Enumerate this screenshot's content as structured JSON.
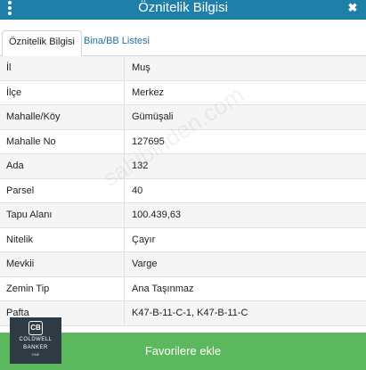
{
  "header": {
    "title": "Öznitelik Bilgisi",
    "menu_icon": "kebab-menu-icon",
    "close_glyph": "✖"
  },
  "tabs": [
    {
      "label": "Öznitelik Bilgisi",
      "active": true
    },
    {
      "label": "Bina/BB Listesi",
      "active": false
    }
  ],
  "rows": [
    {
      "key": "İl",
      "value": "Muş"
    },
    {
      "key": "İlçe",
      "value": "Merkez"
    },
    {
      "key": "Mahalle/Köy",
      "value": "Gümüşali"
    },
    {
      "key": "Mahalle No",
      "value": "127695"
    },
    {
      "key": "Ada",
      "value": "132"
    },
    {
      "key": "Parsel",
      "value": "40"
    },
    {
      "key": "Tapu Alanı",
      "value": "100.439,63"
    },
    {
      "key": "Nitelik",
      "value": "Çayır"
    },
    {
      "key": "Mevkii",
      "value": "Varge"
    },
    {
      "key": "Zemin Tip",
      "value": "Ana Taşınmaz"
    },
    {
      "key": "Pafta",
      "value": "K47-B-11-C-1, K47-B-11-C"
    }
  ],
  "favorite_button": {
    "label": "Favorilere ekle"
  },
  "watermark": {
    "text": "sahibinden.com"
  },
  "logo": {
    "mark": "CB",
    "line1": "COLDWELL",
    "line2": "BANKER",
    "line3": "ONE"
  },
  "colors": {
    "header_bg": "#1e7fa8",
    "tab_link": "#1c6fa0",
    "button_bg": "#5cb85c",
    "logo_bg": "#2e3b44"
  }
}
